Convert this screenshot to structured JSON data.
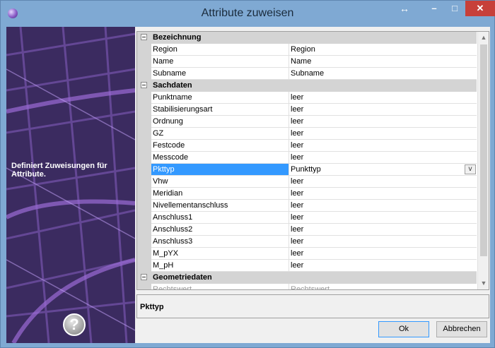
{
  "window": {
    "title": "Attribute zuweisen",
    "resize_glyph": "↔",
    "minimize_glyph": "–",
    "maximize_glyph": "□",
    "close_glyph": "✕"
  },
  "side_panel": {
    "description": "Definiert Zuweisungen für Attribute.",
    "help_glyph": "?"
  },
  "property_grid": {
    "categories": [
      {
        "label": "Bezeichnung",
        "rows": [
          {
            "key": "Region",
            "value": "Region"
          },
          {
            "key": "Name",
            "value": "Name"
          },
          {
            "key": "Subname",
            "value": "Subname"
          }
        ]
      },
      {
        "label": "Sachdaten",
        "rows": [
          {
            "key": "Punktname",
            "value": "leer"
          },
          {
            "key": "Stabilisierungsart",
            "value": "leer"
          },
          {
            "key": "Ordnung",
            "value": "leer"
          },
          {
            "key": "GZ",
            "value": "leer"
          },
          {
            "key": "Festcode",
            "value": "leer"
          },
          {
            "key": "Messcode",
            "value": "leer"
          },
          {
            "key": "Pkttyp",
            "value": "Punkttyp",
            "selected": true
          },
          {
            "key": "Vhw",
            "value": "leer"
          },
          {
            "key": "Meridian",
            "value": "leer"
          },
          {
            "key": "Nivellementanschluss",
            "value": "leer"
          },
          {
            "key": "Anschluss1",
            "value": "leer"
          },
          {
            "key": "Anschluss2",
            "value": "leer"
          },
          {
            "key": "Anschluss3",
            "value": "leer"
          },
          {
            "key": "M_pYX",
            "value": "leer"
          },
          {
            "key": "M_pH",
            "value": "leer"
          }
        ]
      },
      {
        "label": "Geometriedaten",
        "rows": [
          {
            "key": "Rechtswert",
            "value": "Rechtswert"
          }
        ]
      }
    ],
    "dropdown_glyph": "v"
  },
  "description_box": {
    "title": "Pkttyp"
  },
  "buttons": {
    "ok_label": "Ok",
    "cancel_label": "Abbrechen"
  },
  "colors": {
    "title_bar": "#7fa9d3",
    "selection": "#3399ff",
    "close_button": "#c7403a",
    "side_panel": "#3a2a5e"
  }
}
